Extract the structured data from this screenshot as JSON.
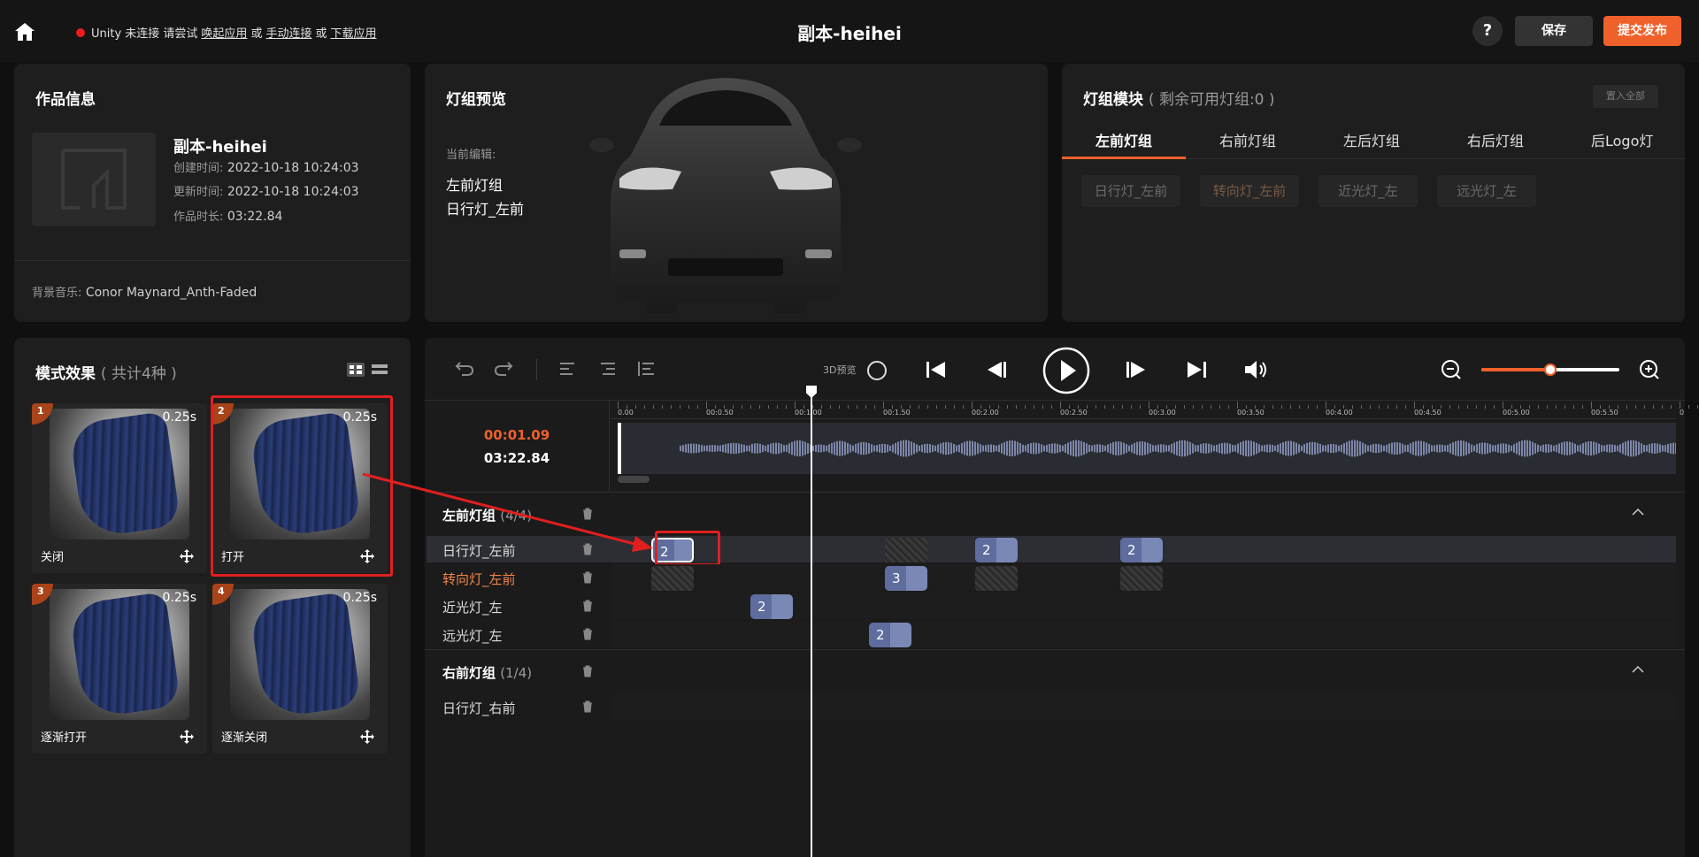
{
  "header": {
    "unity_status_prefix": "Unity 未连接 请尝试",
    "link_launch": "唤起应用",
    "or1": "或",
    "link_connect": "手动连接",
    "or2": "或",
    "link_download": "下载应用",
    "title": "副本-heihei",
    "help_label": "?",
    "save_label": "保存",
    "publish_label": "提交发布"
  },
  "work_info": {
    "title": "作品信息",
    "name": "副本-heihei",
    "created_key": "创建时间:",
    "created_val": "2022-10-18 10:24:03",
    "updated_key": "更新时间:",
    "updated_val": "2022-10-18 10:24:03",
    "duration_key": "作品时长:",
    "duration_val": "03:22.84",
    "music_key": "背景音乐:",
    "music_val": "Conor Maynard_Anth-Faded"
  },
  "preview": {
    "title": "灯组预览",
    "current_label": "当前编辑:",
    "group": "左前灯组",
    "light": "日行灯_左前"
  },
  "modules": {
    "title": "灯组模块",
    "remaining": "( 剩余可用灯组:0 )",
    "put_all": "置入全部",
    "tabs": [
      "左前灯组",
      "右前灯组",
      "左后灯组",
      "右后灯组",
      "后Logo灯"
    ],
    "chips": [
      "日行灯_左前",
      "转向灯_左前",
      "近光灯_左",
      "远光灯_左"
    ]
  },
  "effects": {
    "title": "模式效果",
    "count": "( 共计4种 )",
    "items": [
      {
        "num": "1",
        "duration": "0.25s",
        "label": "关闭"
      },
      {
        "num": "2",
        "duration": "0.25s",
        "label": "打开"
      },
      {
        "num": "3",
        "duration": "0.25s",
        "label": "逐渐打开"
      },
      {
        "num": "4",
        "duration": "0.25s",
        "label": "逐渐关闭"
      }
    ]
  },
  "timeline": {
    "preview3d_label": "3D预览",
    "current_time": "00:01.09",
    "total_time": "03:22.84",
    "zoom_level": 0.5,
    "ruler_ticks": [
      "0.00",
      "00:0.50",
      "00:1.00",
      "00:1.50",
      "00:2.00",
      "00:2.50",
      "00:3.00",
      "00:3.50",
      "00:4.00",
      "00:4.50",
      "00:5.00",
      "00:5.50",
      "0"
    ],
    "groups": [
      {
        "name": "左前灯组",
        "count": "(4/4)",
        "rows": [
          {
            "label": "日行灯_左前",
            "blocks": [
              "2",
              "2",
              "2"
            ]
          },
          {
            "label": "转向灯_左前",
            "blocks": [
              "3"
            ]
          },
          {
            "label": "近光灯_左",
            "blocks": [
              "2"
            ]
          },
          {
            "label": "远光灯_左",
            "blocks": [
              "2"
            ]
          }
        ]
      },
      {
        "name": "右前灯组",
        "count": "(1/4)",
        "rows": [
          {
            "label": "日行灯_右前",
            "blocks": []
          }
        ]
      }
    ]
  },
  "colors": {
    "accent": "#f0602a",
    "block": "#7a88b5",
    "highlight": "#e01f1f",
    "status_dot": "#e81e1e"
  }
}
